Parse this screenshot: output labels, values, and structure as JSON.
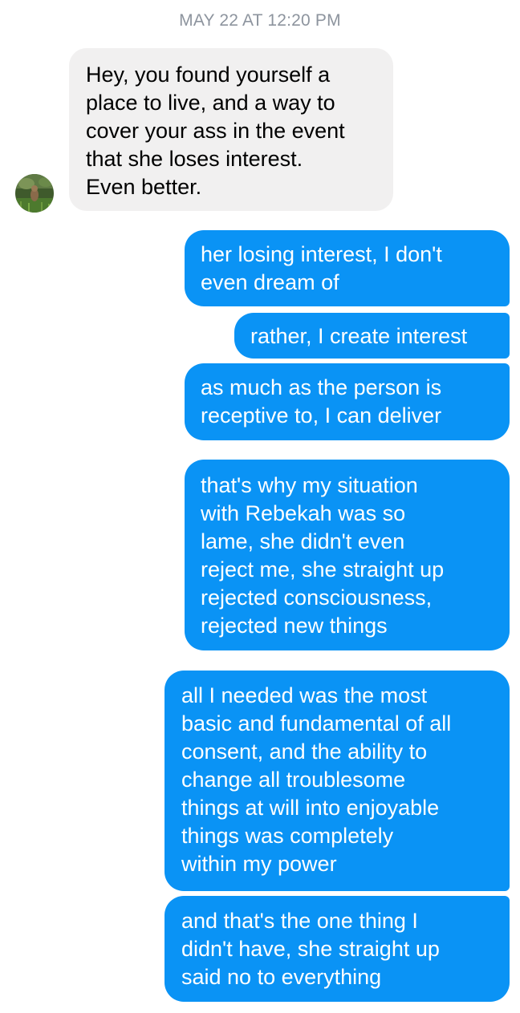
{
  "conversation": {
    "timestamp": "MAY 22 AT 12:20 PM",
    "received": [
      {
        "text": "Hey, you found yourself a\nplace to live, and a way to\ncover your ass in the event\nthat she loses interest.\nEven better."
      }
    ],
    "sent": [
      {
        "text": "her losing interest, I don't\neven dream of"
      },
      {
        "text": "rather, I create interest"
      },
      {
        "text": "as much as the person is\nreceptive to, I can deliver"
      },
      {
        "text": "that's why my situation\nwith Rebekah was so\nlame, she didn't even\nreject me, she straight up\nrejected consciousness,\nrejected new things"
      },
      {
        "text": "all I needed was the most\nbasic and fundamental of all\nconsent, and the ability to\nchange all troublesome\nthings at will into enjoyable\nthings was completely\nwithin my power"
      },
      {
        "text": "and that's the one thing I\ndidn't have, she straight up\nsaid no to everything"
      }
    ]
  },
  "colors": {
    "sent_bubble": "#0a93f5",
    "received_bubble": "#f1f0f0",
    "timestamp_text": "#8d949e"
  },
  "icons": {
    "avatar": "contact-avatar-photo"
  }
}
